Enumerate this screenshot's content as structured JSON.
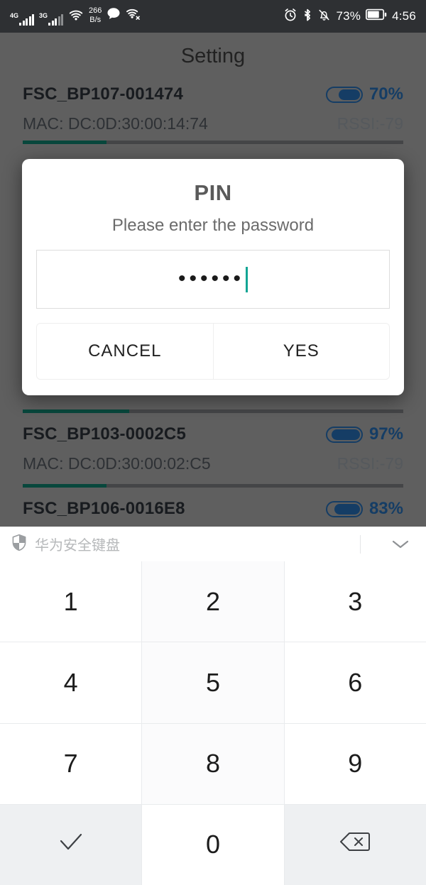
{
  "status_bar": {
    "network_1": "4G",
    "network_2": "3G",
    "wifi_icon": "wifi-icon",
    "data_rate_value": "266",
    "data_rate_unit": "B/s",
    "message_icon": "message-bubble-icon",
    "nfc_icon": "nfc-off-icon",
    "alarm_icon": "alarm-clock-icon",
    "bluetooth_icon": "bluetooth-icon",
    "mute_icon": "notification-muted-icon",
    "battery_percent": "73%",
    "battery_icon": "battery-icon",
    "clock": "4:56"
  },
  "header": {
    "title": "Setting"
  },
  "devices": [
    {
      "name": "FSC_BP107-001474",
      "mac": "MAC: DC:0D:30:00:14:74",
      "rssi": "RSSI:-79",
      "battery_percent": "70%",
      "battery_fill": 70,
      "progress": 22
    },
    {
      "name": "FSC_BP103-0002C5",
      "mac": "MAC: DC:0D:30:00:02:C5",
      "rssi": "RSSI:-79",
      "battery_percent": "97%",
      "battery_fill": 97,
      "progress": 28
    },
    {
      "name": "FSC_BP106-0016E8",
      "mac": "",
      "rssi": "",
      "battery_percent": "83%",
      "battery_fill": 83,
      "progress": 22
    }
  ],
  "dialog": {
    "title": "PIN",
    "subtitle": "Please enter the password",
    "password_masked": "••••••",
    "password_length": 6,
    "placeholder": "",
    "cancel_label": "CANCEL",
    "confirm_label": "YES"
  },
  "keyboard": {
    "shield_icon": "shield-icon",
    "label": "华为安全键盘",
    "collapse_icon": "chevron-down-icon",
    "keys": [
      {
        "label": "1",
        "name": "key-1",
        "style": "num"
      },
      {
        "label": "2",
        "name": "key-2",
        "style": "alt"
      },
      {
        "label": "3",
        "name": "key-3",
        "style": "num"
      },
      {
        "label": "4",
        "name": "key-4",
        "style": "num"
      },
      {
        "label": "5",
        "name": "key-5",
        "style": "alt"
      },
      {
        "label": "6",
        "name": "key-6",
        "style": "num"
      },
      {
        "label": "7",
        "name": "key-7",
        "style": "num"
      },
      {
        "label": "8",
        "name": "key-8",
        "style": "alt"
      },
      {
        "label": "9",
        "name": "key-9",
        "style": "num"
      }
    ],
    "bottom_row": {
      "confirm_icon": "checkmark-icon",
      "zero_label": "0",
      "backspace_icon": "backspace-icon"
    }
  },
  "colors": {
    "accent_blue": "#1b4f82",
    "progress_green": "#0b5c4e",
    "caret_teal": "#12a594",
    "status_bar_bg": "#2e3033",
    "page_bg": "#7a7a7a"
  }
}
